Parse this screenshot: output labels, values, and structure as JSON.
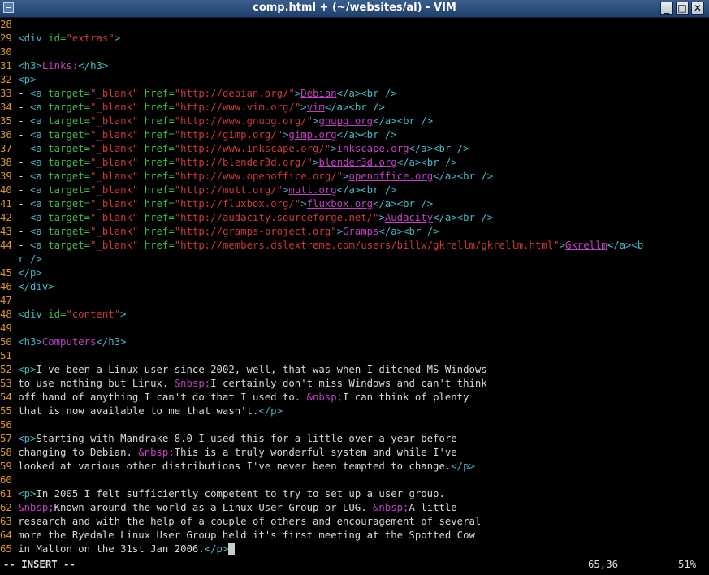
{
  "window": {
    "title": "comp.html + (~/websites/al) - VIM",
    "buttons": {
      "minimize": "_",
      "maximize": "□",
      "close": "✕"
    }
  },
  "colors": {
    "background": "#000000",
    "line_number": "#d9952d",
    "tag": "#4ab7c8",
    "attribute": "#3dbd45",
    "string": "#cc3b3b",
    "link_text": "#c040c0",
    "entity": "#c040c0",
    "text": "#d8d8d8"
  },
  "buffer": {
    "lines": [
      {
        "n": "28",
        "segs": []
      },
      {
        "n": "29",
        "segs": [
          [
            "t",
            "<div "
          ],
          [
            "a",
            "id="
          ],
          [
            "s",
            "\"extras\""
          ],
          [
            "t",
            ">"
          ]
        ]
      },
      {
        "n": "30",
        "segs": []
      },
      {
        "n": "31",
        "segs": [
          [
            "t",
            "<h3>"
          ],
          [
            "e",
            "Links:"
          ],
          [
            "t",
            "</h3>"
          ]
        ]
      },
      {
        "n": "32",
        "segs": [
          [
            "t",
            "<p>"
          ]
        ]
      },
      {
        "n": "33",
        "segs": [
          [
            "x",
            "- "
          ],
          [
            "t",
            "<a "
          ],
          [
            "a",
            "target="
          ],
          [
            "s",
            "\"_blank\""
          ],
          [
            "x",
            " "
          ],
          [
            "a",
            "href="
          ],
          [
            "s",
            "\"http://debian.org/\""
          ],
          [
            "t",
            ">"
          ],
          [
            "m",
            "Debian"
          ],
          [
            "t",
            "</a><br />"
          ]
        ]
      },
      {
        "n": "34",
        "segs": [
          [
            "x",
            "- "
          ],
          [
            "t",
            "<a "
          ],
          [
            "a",
            "target="
          ],
          [
            "s",
            "\"_blank\""
          ],
          [
            "x",
            " "
          ],
          [
            "a",
            "href="
          ],
          [
            "s",
            "\"http://www.vim.org/\""
          ],
          [
            "t",
            ">"
          ],
          [
            "m",
            "vim"
          ],
          [
            "t",
            "</a><br />"
          ]
        ]
      },
      {
        "n": "35",
        "segs": [
          [
            "x",
            "- "
          ],
          [
            "t",
            "<a "
          ],
          [
            "a",
            "target="
          ],
          [
            "s",
            "\"_blank\""
          ],
          [
            "x",
            " "
          ],
          [
            "a",
            "href="
          ],
          [
            "s",
            "\"http://www.gnupg.org/\""
          ],
          [
            "t",
            ">"
          ],
          [
            "m",
            "gnupg.org"
          ],
          [
            "t",
            "</a><br />"
          ]
        ]
      },
      {
        "n": "36",
        "segs": [
          [
            "x",
            "- "
          ],
          [
            "t",
            "<a "
          ],
          [
            "a",
            "target="
          ],
          [
            "s",
            "\"_blank\""
          ],
          [
            "x",
            " "
          ],
          [
            "a",
            "href="
          ],
          [
            "s",
            "\"http://gimp.org/\""
          ],
          [
            "t",
            ">"
          ],
          [
            "m",
            "gimp.org"
          ],
          [
            "t",
            "</a><br />"
          ]
        ]
      },
      {
        "n": "37",
        "segs": [
          [
            "x",
            "- "
          ],
          [
            "t",
            "<a "
          ],
          [
            "a",
            "target="
          ],
          [
            "s",
            "\"_blank\""
          ],
          [
            "x",
            " "
          ],
          [
            "a",
            "href="
          ],
          [
            "s",
            "\"http://www.inkscape.org/\""
          ],
          [
            "t",
            ">"
          ],
          [
            "m",
            "inkscape.org"
          ],
          [
            "t",
            "</a><br />"
          ]
        ]
      },
      {
        "n": "38",
        "segs": [
          [
            "x",
            "- "
          ],
          [
            "t",
            "<a "
          ],
          [
            "a",
            "target="
          ],
          [
            "s",
            "\"_blank\""
          ],
          [
            "x",
            " "
          ],
          [
            "a",
            "href="
          ],
          [
            "s",
            "\"http://blender3d.org/\""
          ],
          [
            "t",
            ">"
          ],
          [
            "m",
            "blender3d.org"
          ],
          [
            "t",
            "</a><br />"
          ]
        ]
      },
      {
        "n": "39",
        "segs": [
          [
            "x",
            "- "
          ],
          [
            "t",
            "<a "
          ],
          [
            "a",
            "target="
          ],
          [
            "s",
            "\"_blank\""
          ],
          [
            "x",
            " "
          ],
          [
            "a",
            "href="
          ],
          [
            "s",
            "\"http://www.openoffice.org/\""
          ],
          [
            "t",
            ">"
          ],
          [
            "m",
            "openoffice.org"
          ],
          [
            "t",
            "</a><br />"
          ]
        ]
      },
      {
        "n": "40",
        "segs": [
          [
            "x",
            "- "
          ],
          [
            "t",
            "<a "
          ],
          [
            "a",
            "target="
          ],
          [
            "s",
            "\"_blank\""
          ],
          [
            "x",
            " "
          ],
          [
            "a",
            "href="
          ],
          [
            "s",
            "\"http://mutt.org/\""
          ],
          [
            "t",
            ">"
          ],
          [
            "m",
            "mutt.org"
          ],
          [
            "t",
            "</a><br />"
          ]
        ]
      },
      {
        "n": "41",
        "segs": [
          [
            "x",
            "- "
          ],
          [
            "t",
            "<a "
          ],
          [
            "a",
            "target="
          ],
          [
            "s",
            "\"_blank\""
          ],
          [
            "x",
            " "
          ],
          [
            "a",
            "href="
          ],
          [
            "s",
            "\"http://fluxbox.org/\""
          ],
          [
            "t",
            ">"
          ],
          [
            "m",
            "fluxbox.org"
          ],
          [
            "t",
            "</a><br />"
          ]
        ]
      },
      {
        "n": "42",
        "segs": [
          [
            "x",
            "- "
          ],
          [
            "t",
            "<a "
          ],
          [
            "a",
            "target="
          ],
          [
            "s",
            "\"_blank\""
          ],
          [
            "x",
            " "
          ],
          [
            "a",
            "href="
          ],
          [
            "s",
            "\"http://audacity.sourceforge.net/\""
          ],
          [
            "t",
            ">"
          ],
          [
            "m",
            "Audacity"
          ],
          [
            "t",
            "</a><br />"
          ]
        ]
      },
      {
        "n": "43",
        "segs": [
          [
            "x",
            "- "
          ],
          [
            "t",
            "<a "
          ],
          [
            "a",
            "target="
          ],
          [
            "s",
            "\"_blank\""
          ],
          [
            "x",
            " "
          ],
          [
            "a",
            "href="
          ],
          [
            "s",
            "\"http://gramps-project.org\""
          ],
          [
            "t",
            ">"
          ],
          [
            "m",
            "Gramps"
          ],
          [
            "t",
            "</a><br />"
          ]
        ]
      },
      {
        "n": "44",
        "segs": [
          [
            "x",
            "- "
          ],
          [
            "t",
            "<a "
          ],
          [
            "a",
            "target="
          ],
          [
            "s",
            "\"_blank\""
          ],
          [
            "x",
            " "
          ],
          [
            "a",
            "href="
          ],
          [
            "s",
            "\"http://members.dslextreme.com/users/billw/gkrellm/gkrellm.html\""
          ],
          [
            "t",
            ">"
          ],
          [
            "m",
            "Gkrellm"
          ],
          [
            "t",
            "</a><b"
          ]
        ]
      },
      {
        "n": "",
        "segs": [
          [
            "t",
            "r />"
          ]
        ]
      },
      {
        "n": "45",
        "segs": [
          [
            "t",
            "</p>"
          ]
        ]
      },
      {
        "n": "46",
        "segs": [
          [
            "t",
            "</div>"
          ]
        ]
      },
      {
        "n": "47",
        "segs": []
      },
      {
        "n": "48",
        "segs": [
          [
            "t",
            "<div "
          ],
          [
            "a",
            "id="
          ],
          [
            "s",
            "\"content\""
          ],
          [
            "t",
            ">"
          ]
        ]
      },
      {
        "n": "49",
        "segs": []
      },
      {
        "n": "50",
        "segs": [
          [
            "t",
            "<h3>"
          ],
          [
            "e",
            "Computers"
          ],
          [
            "t",
            "</h3>"
          ]
        ]
      },
      {
        "n": "51",
        "segs": []
      },
      {
        "n": "52",
        "segs": [
          [
            "t",
            "<p>"
          ],
          [
            "x",
            "I've been a Linux user since 2002, well, that was when I ditched MS Windows"
          ]
        ]
      },
      {
        "n": "53",
        "segs": [
          [
            "x",
            "to use nothing but Linux. "
          ],
          [
            "e",
            "&nbsp;"
          ],
          [
            "x",
            "I certainly don't miss Windows and can't think"
          ]
        ]
      },
      {
        "n": "54",
        "segs": [
          [
            "x",
            "off hand of anything I can't do that I used to. "
          ],
          [
            "e",
            "&nbsp;"
          ],
          [
            "x",
            "I can think of plenty"
          ]
        ]
      },
      {
        "n": "55",
        "segs": [
          [
            "x",
            "that is now available to me that wasn't."
          ],
          [
            "t",
            "</p>"
          ]
        ]
      },
      {
        "n": "56",
        "segs": []
      },
      {
        "n": "57",
        "segs": [
          [
            "t",
            "<p>"
          ],
          [
            "x",
            "Starting with Mandrake 8.0 I used this for a little over a year before"
          ]
        ]
      },
      {
        "n": "58",
        "segs": [
          [
            "x",
            "changing to Debian. "
          ],
          [
            "e",
            "&nbsp;"
          ],
          [
            "x",
            "This is a truly wonderful system and while I've"
          ]
        ]
      },
      {
        "n": "59",
        "segs": [
          [
            "x",
            "looked at various other distributions I've never been tempted to change."
          ],
          [
            "t",
            "</p>"
          ]
        ]
      },
      {
        "n": "60",
        "segs": []
      },
      {
        "n": "61",
        "segs": [
          [
            "t",
            "<p>"
          ],
          [
            "x",
            "In 2005 I felt sufficiently competent to try to set up a user group."
          ]
        ]
      },
      {
        "n": "62",
        "segs": [
          [
            "e",
            "&nbsp;"
          ],
          [
            "x",
            "Known around the world as a Linux User Group or LUG. "
          ],
          [
            "e",
            "&nbsp;"
          ],
          [
            "x",
            "A little"
          ]
        ]
      },
      {
        "n": "63",
        "segs": [
          [
            "x",
            "research and with the help of a couple of others and encouragement of several"
          ]
        ]
      },
      {
        "n": "64",
        "segs": [
          [
            "x",
            "more the Ryedale Linux User Group held it's first meeting at the Spotted Cow"
          ]
        ]
      },
      {
        "n": "65",
        "segs": [
          [
            "x",
            "in Malton on the 31st Jan 2006."
          ],
          [
            "t",
            "</p>"
          ]
        ],
        "cursor": true
      }
    ]
  },
  "status": {
    "mode": "-- INSERT --",
    "position": "65,36",
    "percent": "51%"
  }
}
